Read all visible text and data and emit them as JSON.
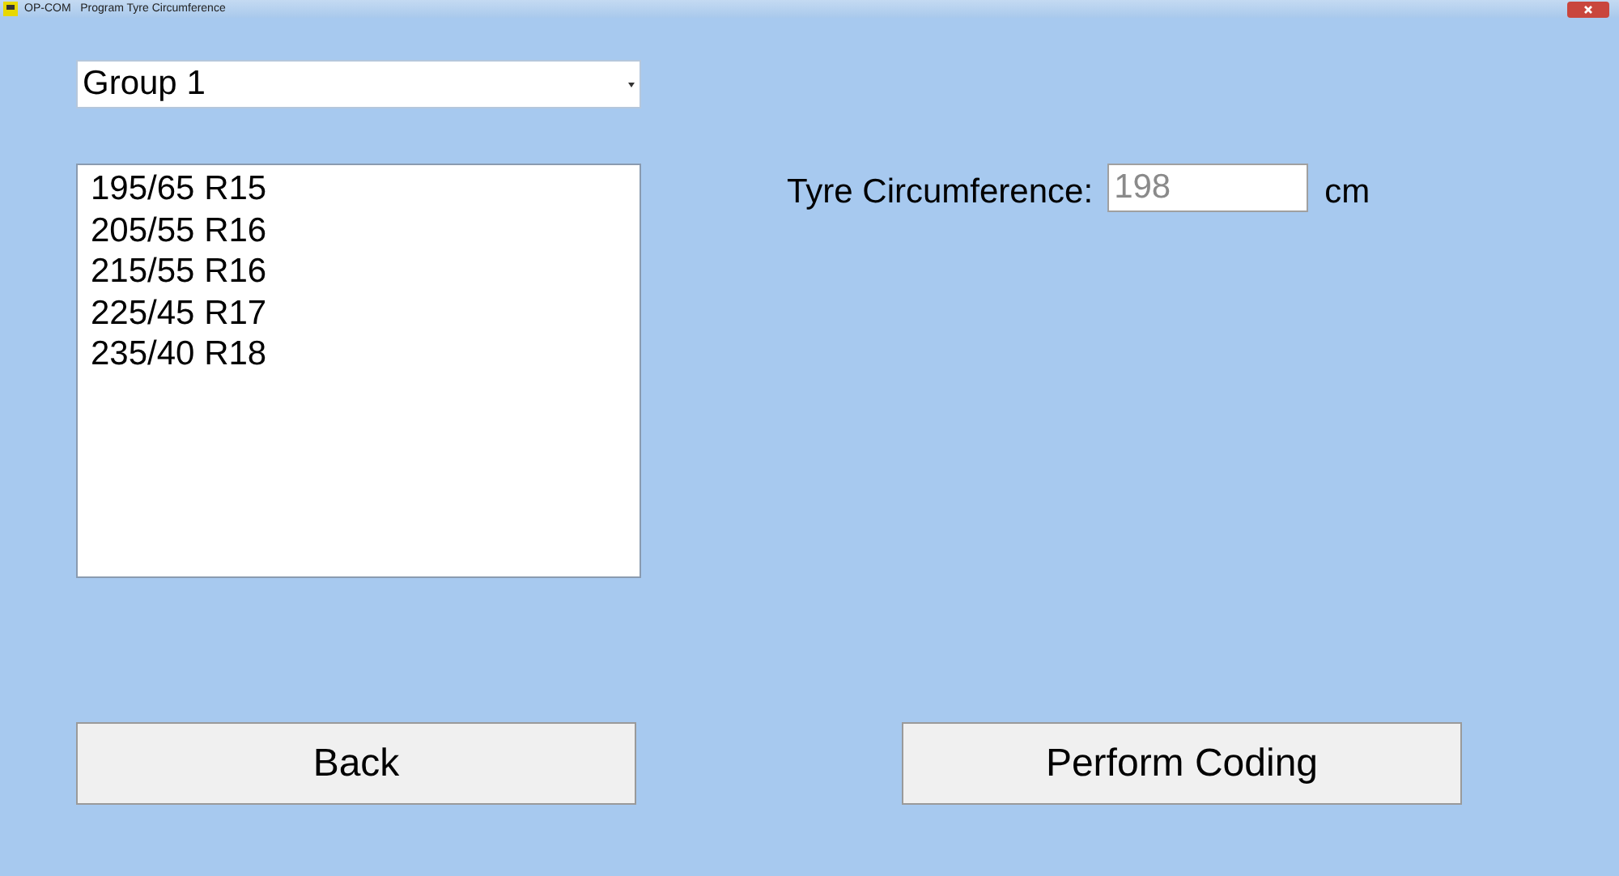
{
  "window": {
    "title": "OP-COM   Program Tyre Circumference"
  },
  "group_select": {
    "value": "Group 1"
  },
  "tyre_sizes": [
    {
      "label": "195/65 R15",
      "selected": false
    },
    {
      "label": "205/55 R16",
      "selected": false
    },
    {
      "label": "215/55 R16",
      "selected": false
    },
    {
      "label": "225/45 R17",
      "selected": false
    },
    {
      "label": "235/40 R18",
      "selected": false
    }
  ],
  "circumference": {
    "label": "Tyre Circumference:",
    "value": "198",
    "disabled": true,
    "unit": "cm"
  },
  "buttons": [
    "Back",
    "Perform Coding"
  ]
}
